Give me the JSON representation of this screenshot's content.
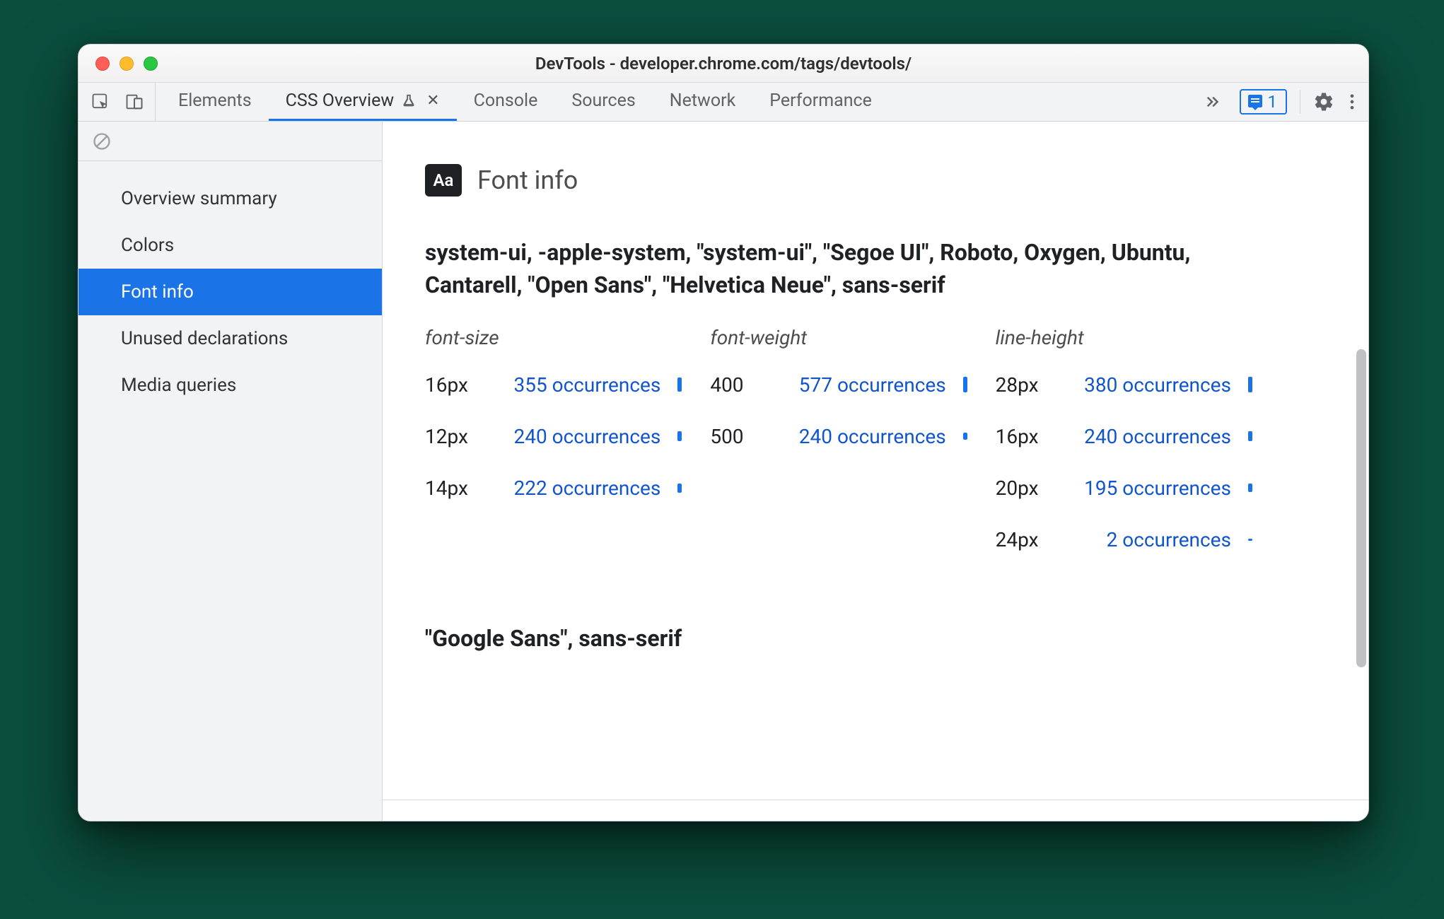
{
  "window": {
    "title": "DevTools - developer.chrome.com/tags/devtools/"
  },
  "tabs": {
    "items": [
      {
        "label": "Elements",
        "active": false
      },
      {
        "label": "CSS Overview",
        "active": true,
        "experimental": true,
        "closable": true
      },
      {
        "label": "Console",
        "active": false
      },
      {
        "label": "Sources",
        "active": false
      },
      {
        "label": "Network",
        "active": false
      },
      {
        "label": "Performance",
        "active": false
      }
    ],
    "issues_count": "1"
  },
  "sidebar": {
    "items": [
      {
        "label": "Overview summary",
        "selected": false
      },
      {
        "label": "Colors",
        "selected": false
      },
      {
        "label": "Font info",
        "selected": true
      },
      {
        "label": "Unused declarations",
        "selected": false
      },
      {
        "label": "Media queries",
        "selected": false
      }
    ]
  },
  "content": {
    "aa_label": "Aa",
    "section_title": "Font info",
    "font_family_1": "system-ui, -apple-system, \"system-ui\", \"Segoe UI\", Roboto, Oxygen, Ubuntu, Cantarell, \"Open Sans\", \"Helvetica Neue\", sans-serif",
    "columns": {
      "font_size": {
        "header": "font-size",
        "rows": [
          {
            "value": "16px",
            "occ": "355 occurrences",
            "bar": 20
          },
          {
            "value": "12px",
            "occ": "240 occurrences",
            "bar": 14
          },
          {
            "value": "14px",
            "occ": "222 occurrences",
            "bar": 13
          }
        ]
      },
      "font_weight": {
        "header": "font-weight",
        "rows": [
          {
            "value": "400",
            "occ": "577 occurrences",
            "bar": 22
          },
          {
            "value": "500",
            "occ": "240 occurrences",
            "bar": 10
          }
        ]
      },
      "line_height": {
        "header": "line-height",
        "rows": [
          {
            "value": "28px",
            "occ": "380 occurrences",
            "bar": 22
          },
          {
            "value": "16px",
            "occ": "240 occurrences",
            "bar": 14
          },
          {
            "value": "20px",
            "occ": "195 occurrences",
            "bar": 12
          },
          {
            "value": "24px",
            "occ": "2 occurrences",
            "bar": 3
          }
        ]
      }
    },
    "font_family_2": "\"Google Sans\", sans-serif"
  }
}
